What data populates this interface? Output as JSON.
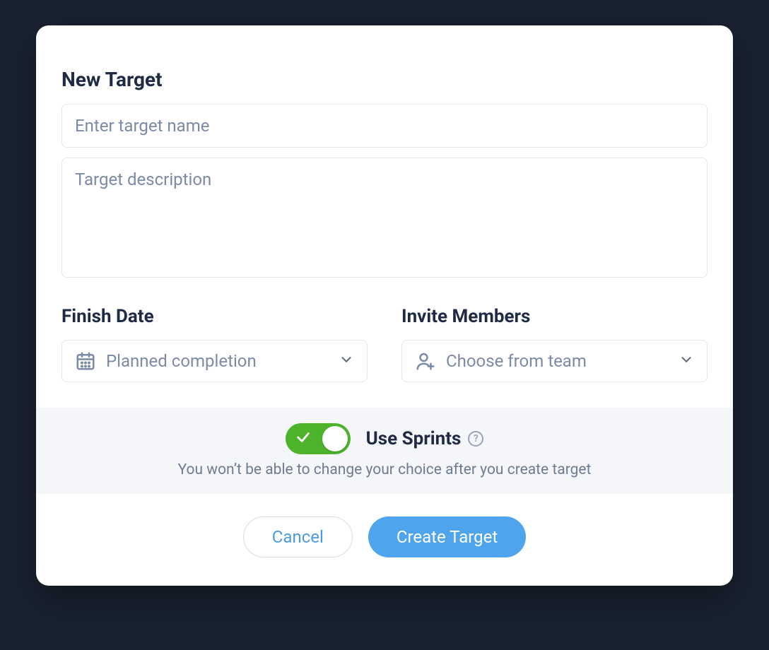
{
  "modal": {
    "title": "New Target",
    "name_placeholder": "Enter target name",
    "description_placeholder": "Target description",
    "finish_date": {
      "label": "Finish Date",
      "placeholder": "Planned completion"
    },
    "invite_members": {
      "label": "Invite Members",
      "placeholder": "Choose from team"
    },
    "sprints": {
      "toggle_on": true,
      "label": "Use Sprints",
      "help_glyph": "?",
      "note": "You won’t be able to change your choice after you create target"
    },
    "buttons": {
      "cancel": "Cancel",
      "create": "Create Target"
    }
  },
  "colors": {
    "background": "#192231",
    "card": "#ffffff",
    "heading": "#1f2a44",
    "placeholder": "#7b8aa6",
    "border": "#e3e6ea",
    "band": "#f4f6f9",
    "toggle_on": "#4cb32b",
    "primary": "#4ea4ed",
    "link": "#4b9ae3",
    "muted": "#6e7c93"
  }
}
